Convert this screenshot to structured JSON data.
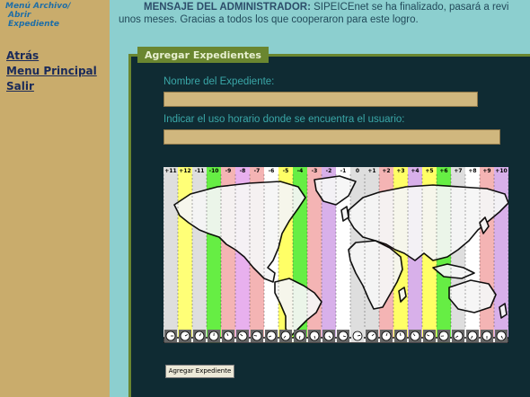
{
  "sidebar": {
    "breadcrumb": [
      "Menú Archivo/",
      "Abrir",
      "Expediente"
    ],
    "links": [
      "Atrás",
      "Menu Principal",
      "Salir"
    ]
  },
  "admin_message": {
    "heading": "MENSAJE DEL ADMINISTRADOR:",
    "line1": "SIPEICEnet se ha finalizado, pasará a revi",
    "line2": "unos meses. Gracias a todos los que cooperaron para este logro."
  },
  "panel": {
    "tab_label": "Agregar Expedientes",
    "name_label": "Nombre del Expediente:",
    "name_value": "",
    "tz_label": "Indicar el uso horario donde se encuentra el usuario:",
    "tz_value": "",
    "submit_label": "Agregar Expediente"
  },
  "timezone_map": {
    "offsets": [
      "+11",
      "+12",
      "-11",
      "-10",
      "-9",
      "-8",
      "-7",
      "-6",
      "-5",
      "-4",
      "-3",
      "-2",
      "-1",
      "0",
      "+1",
      "+2",
      "+3",
      "+4",
      "+5",
      "+6",
      "+7",
      "+8",
      "+9",
      "+10"
    ],
    "colors": {
      "+11": "#dedede",
      "+12": "#ffff77",
      "-11": "#dedede",
      "-10": "#66ee44",
      "-9": "#f4b4b4",
      "-8": "#e8b0ee",
      "-7": "#f4b4b4",
      "-6": "#ffffff",
      "-5": "#ffff66",
      "-4": "#66ee44",
      "-3": "#f4b4b4",
      "-2": "#d8b0ea",
      "-1": "#ffffff",
      "0": "#dedede",
      "+1": "#dedede",
      "+2": "#f4b4b4",
      "+3": "#ffff66",
      "+4": "#d8b0ea",
      "+5": "#ffff66",
      "+6": "#66ee44",
      "+7": "#dedede",
      "+8": "#ffffff",
      "+9": "#f4b4b4",
      "+10": "#d8b0ea"
    }
  }
}
